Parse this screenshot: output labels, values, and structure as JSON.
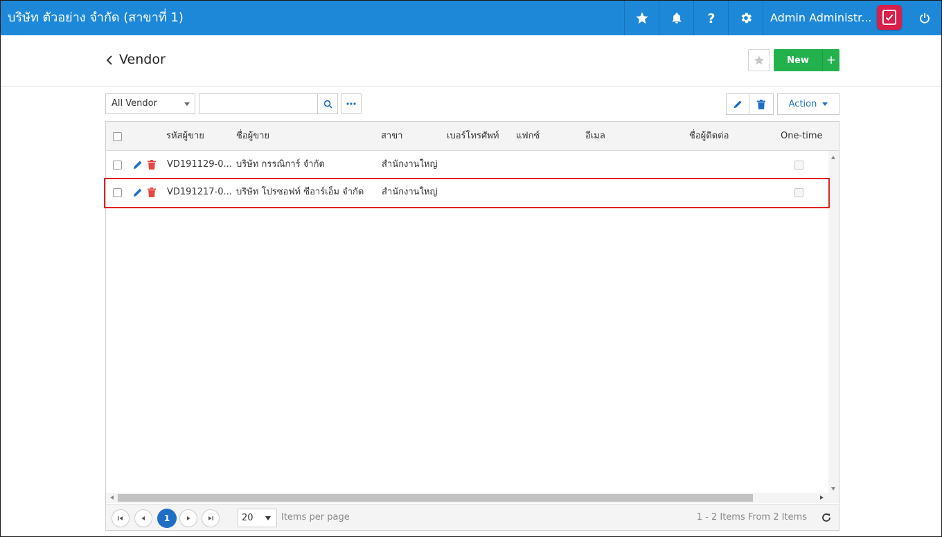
{
  "topbar": {
    "app_title": "บริษัท ตัวอย่าง จำกัด (สาขาที่ 1)",
    "user_name": "Admin Administr...",
    "icons": [
      "star-icon",
      "bell-icon",
      "help-icon",
      "gear-icon",
      "power-icon"
    ],
    "accent_color": "#1e88d8"
  },
  "page": {
    "title": "Vendor",
    "new_label": "New",
    "new_plus": "+"
  },
  "toolbar": {
    "filter_value": "All Vendor",
    "search_value": "",
    "search_placeholder": "",
    "action_label": "Action"
  },
  "grid": {
    "columns": [
      "รหัสผู้ขาย",
      "ชื่อผู้ขาย",
      "สาขา",
      "เบอร์โทรศัพท์",
      "แฟกซ์",
      "อีเมล",
      "ชื่อผู้ติดต่อ",
      "One-time"
    ],
    "rows": [
      {
        "code": "VD191129-0...",
        "name": "บริษัท กรรณิการ์ จำกัด",
        "branch": "สำนักงานใหญ่",
        "phone": "",
        "fax": "",
        "email": "",
        "contact": "",
        "one_time": false,
        "highlighted": false
      },
      {
        "code": "VD191217-0...",
        "name": "บริษัท โปรซอฟท์ ซีอาร์เอ็ม จำกัด",
        "branch": "สำนักงานใหญ่",
        "phone": "",
        "fax": "",
        "email": "",
        "contact": "",
        "one_time": false,
        "highlighted": true
      }
    ]
  },
  "pager": {
    "current_page": "1",
    "page_size": "20",
    "items_per_page_label": "Items per page",
    "summary": "1 - 2 Items From 2 Items"
  }
}
